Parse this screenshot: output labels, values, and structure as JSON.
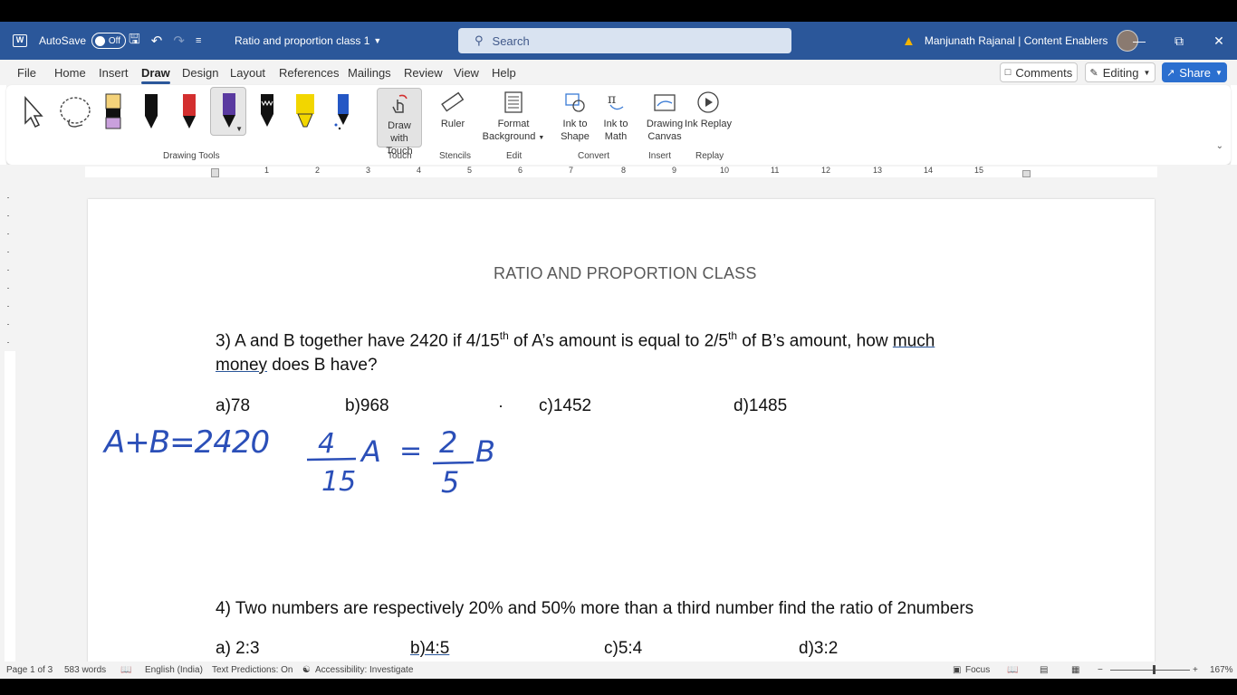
{
  "titlebar": {
    "autosave_label": "AutoSave",
    "autosave_state": "Off",
    "document_title": "Ratio and proportion class 1",
    "search_placeholder": "Search",
    "user_name": "Manjunath Rajanal | Content Enablers"
  },
  "tabs": [
    "File",
    "Home",
    "Insert",
    "Draw",
    "Design",
    "Layout",
    "References",
    "Mailings",
    "Review",
    "View",
    "Help"
  ],
  "active_tab": "Draw",
  "ribbon_buttons": {
    "comments": "Comments",
    "editing": "Editing",
    "share": "Share"
  },
  "ribbon": {
    "tools": {
      "draw_with_touch": "Draw with Touch",
      "ruler": "Ruler",
      "format_background": "Format Background",
      "ink_to_shape": "Ink to Shape",
      "ink_to_math": "Ink to Math",
      "drawing_canvas": "Drawing Canvas",
      "ink_replay": "Ink Replay"
    },
    "groups": {
      "drawing_tools": "Drawing Tools",
      "touch": "Touch",
      "stencils": "Stencils",
      "edit": "Edit",
      "convert": "Convert",
      "insert": "Insert",
      "replay": "Replay"
    },
    "pen_colors": [
      "#111111",
      "#d32f2f",
      "#5a3aa0",
      "#111111",
      "#f2d600",
      "#2457c5"
    ]
  },
  "ruler_numbers": [
    "1",
    "2",
    "3",
    "4",
    "5",
    "6",
    "7",
    "8",
    "9",
    "10",
    "11",
    "12",
    "13",
    "14",
    "15"
  ],
  "document": {
    "heading": "RATIO AND PROPORTION CLASS",
    "q3": {
      "part1": "3) A and B together have 2420 if 4/15",
      "sup1": "th",
      "part2": " of A’s amount is equal to 2/5",
      "sup2": "th",
      "part3": " of B’s amount, how ",
      "underlined1": "much",
      "line2_underlined": "money",
      "line2_rest": " does B have?",
      "options": [
        "a)78",
        "b)968",
        "c)1452",
        "d)1485"
      ]
    },
    "ink_notes": {
      "eq1": "A+B=2420",
      "frac1_num": "4",
      "frac1_den": "15",
      "var_a": "A",
      "equals": "=",
      "frac2_num": "2",
      "frac2_den": "5",
      "var_b": "B"
    },
    "q4": {
      "text": "4) Two numbers are respectively 20% and 50% more than a third number find the ratio of 2numbers",
      "options": [
        "a) 2:3",
        "b)4:5",
        "c)5:4",
        "d)3:2"
      ]
    }
  },
  "statusbar": {
    "page": "Page 1 of 3",
    "words": "583 words",
    "language": "English (India)",
    "text_predictions": "Text Predictions: On",
    "accessibility": "Accessibility: Investigate",
    "focus": "Focus",
    "zoom_percent": "167%",
    "zoom_level": 1.67
  },
  "colors": {
    "titlebar": "#2b579a",
    "ink": "#2b4fb8",
    "accent": "#2b579a"
  }
}
